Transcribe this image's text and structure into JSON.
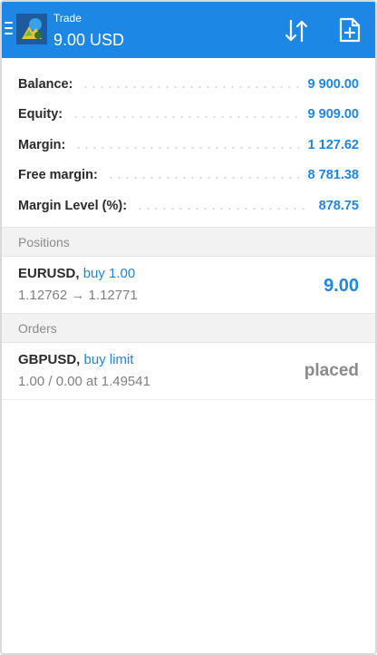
{
  "header": {
    "title": "Trade",
    "amount": "9.00 USD",
    "menu_icon": "hamburger-menu-icon",
    "logo_icon": "app-logo-icon",
    "sort_icon": "sort-arrows-icon",
    "new_order_icon": "new-order-icon"
  },
  "account": {
    "rows": [
      {
        "label": "Balance:",
        "value": "9 900.00"
      },
      {
        "label": "Equity:",
        "value": "9 909.00"
      },
      {
        "label": "Margin:",
        "value": "1 127.62"
      },
      {
        "label": "Free margin:",
        "value": "8 781.38"
      },
      {
        "label": "Margin Level (%):",
        "value": "878.75"
      }
    ]
  },
  "positions": {
    "header": "Positions",
    "items": [
      {
        "symbol": "EURUSD,",
        "action": "buy 1.00",
        "prices": "1.12762 → 1.12771",
        "profit": "9.00"
      }
    ]
  },
  "orders": {
    "header": "Orders",
    "items": [
      {
        "symbol": "GBPUSD,",
        "action": "buy limit",
        "details": "1.00 / 0.00 at 1.49541",
        "status": "placed"
      }
    ]
  },
  "colors": {
    "accent": "#1d87e5",
    "section_bg": "#f2f2f2",
    "muted": "#8b8b8b"
  }
}
